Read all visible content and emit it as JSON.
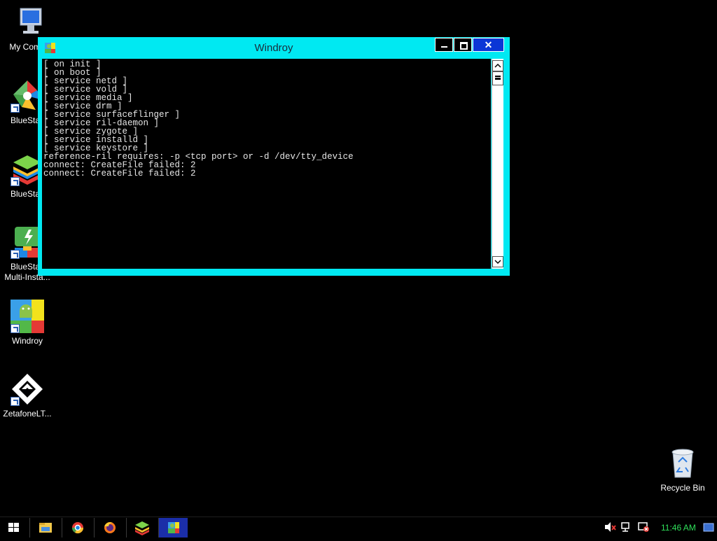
{
  "desktop_icons": [
    {
      "label": "My Comp",
      "icon": "my-computer-icon"
    },
    {
      "label": "BlueStac",
      "icon": "bluestacks-icon"
    },
    {
      "label": "BlueStac",
      "icon": "bluestacks-layers-icon"
    },
    {
      "label": "BlueStac\nMulti-Insta...",
      "icon": "bluestacks-multi-instance-icon"
    },
    {
      "label": "Windroy",
      "icon": "windroy-icon"
    },
    {
      "label": "ZetafoneLT...",
      "icon": "zetafone-icon"
    },
    {
      "label": "Recycle Bin",
      "icon": "recycle-bin-icon"
    }
  ],
  "window": {
    "title": "Windroy",
    "close_label": "✕",
    "console_text": "[ on init ]\n[ on boot ]\n[ service netd ]\n[ service vold ]\n[ service media ]\n[ service drm ]\n[ service surfaceflinger ]\n[ service ril-daemon ]\n[ service zygote ]\n[ service installd ]\n[ service keystore ]\nreference-ril requires: -p <tcp port> or -d /dev/tty_device\nconnect: CreateFile failed: 2\nconnect: CreateFile failed: 2"
  },
  "taskbar": {
    "items": [
      "start-icon",
      "file-explorer-icon",
      "chrome-icon",
      "firefox-icon",
      "bluestacks-icon",
      "windroy-icon"
    ],
    "clock": "11:46 AM"
  },
  "colors": {
    "window_frame": "#00e9f2",
    "close_button": "#0b36d6",
    "active_task": "#1b2ea8",
    "clock": "#2fe05a"
  }
}
